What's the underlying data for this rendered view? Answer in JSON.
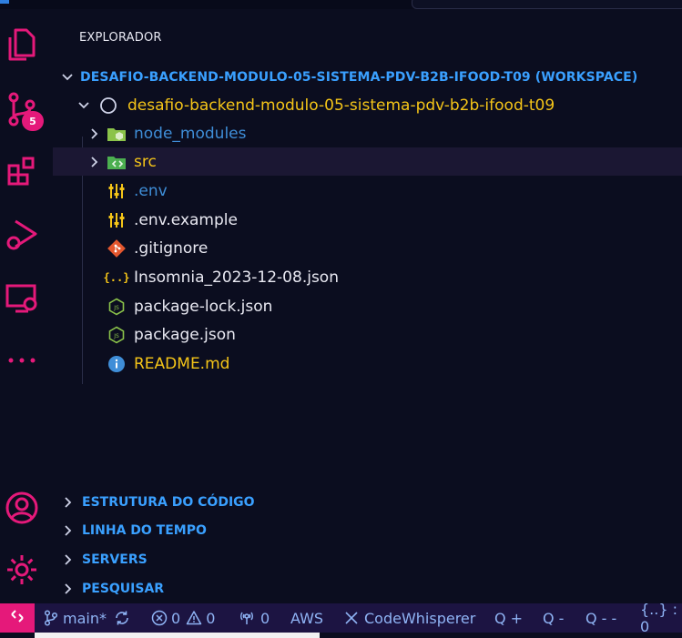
{
  "explorer": {
    "title": "EXPLORADOR"
  },
  "workspace": {
    "label": "DESAFIO-BACKEND-MODULO-05-SISTEMA-PDV-B2B-IFOOD-T09 (WORKSPACE)"
  },
  "project": {
    "label": "desafio-backend-modulo-05-sistema-pdv-b2b-ifood-t09"
  },
  "files": [
    {
      "label": "node_modules",
      "icon": "folder-node-icon",
      "color": "#3f8ed8"
    },
    {
      "label": "src",
      "icon": "folder-src-icon",
      "color": "#f5c518"
    },
    {
      "label": ".env",
      "icon": "settings-sliders-icon",
      "color": "#3f8ed8"
    },
    {
      "label": ".env.example",
      "icon": "settings-sliders-icon",
      "color": "#e9e9f2"
    },
    {
      "label": ".gitignore",
      "icon": "git-icon",
      "color": "#e9e9f2"
    },
    {
      "label": "Insomnia_2023-12-08.json",
      "icon": "json-braces-icon",
      "color": "#e9e9f2"
    },
    {
      "label": "package-lock.json",
      "icon": "nodejs-icon",
      "color": "#e9e9f2"
    },
    {
      "label": "package.json",
      "icon": "nodejs-icon",
      "color": "#e9e9f2"
    },
    {
      "label": "README.md",
      "icon": "info-icon",
      "color": "#f5c518"
    }
  ],
  "sections": [
    {
      "label": "ESTRUTURA DO CÓDIGO"
    },
    {
      "label": "LINHA DO TEMPO"
    },
    {
      "label": "SERVERS"
    },
    {
      "label": "PESQUISAR"
    }
  ],
  "activity": {
    "scm_badge": "5"
  },
  "status": {
    "branch": "main*",
    "errors": "0",
    "warnings": "0",
    "ports": "0",
    "aws": "AWS",
    "codewhisperer": "CodeWhisperer",
    "q_plus": "Q +",
    "q_minus": "Q -",
    "q_minus_minus": "Q - -",
    "json_count": "{..} : 0"
  }
}
